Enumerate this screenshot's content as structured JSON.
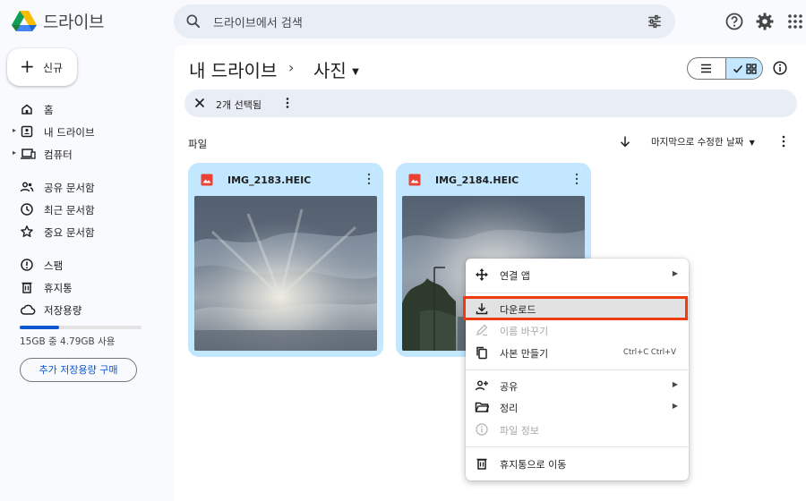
{
  "header": {
    "brand": "드라이브",
    "search_placeholder": "드라이브에서 검색"
  },
  "sidebar": {
    "new_label": "신규",
    "items": [
      {
        "label": "홈",
        "icon": "home-icon"
      },
      {
        "label": "내 드라이브",
        "icon": "my-drive-icon"
      },
      {
        "label": "컴퓨터",
        "icon": "computer-icon"
      },
      {
        "label": "공유 문서함",
        "icon": "shared-icon"
      },
      {
        "label": "최근 문서함",
        "icon": "recent-icon"
      },
      {
        "label": "중요 문서함",
        "icon": "star-icon"
      },
      {
        "label": "스팸",
        "icon": "spam-icon"
      },
      {
        "label": "휴지통",
        "icon": "trash-icon"
      },
      {
        "label": "저장용량",
        "icon": "cloud-icon"
      }
    ],
    "storage_text": "15GB 중 4.79GB 사용",
    "storage_fraction": 0.32,
    "buy_label": "추가 저장용량 구매"
  },
  "breadcrumb": {
    "root": "내 드라이브",
    "separator": "›",
    "current": "사진"
  },
  "selection": {
    "count_label": "2개 선택됨"
  },
  "files": {
    "section_label": "파일",
    "sort_label": "마지막으로 수정한 날짜",
    "items": [
      {
        "name": "IMG_2183.HEIC"
      },
      {
        "name": "IMG_2184.HEIC"
      }
    ]
  },
  "context_menu": {
    "open_with": "연결 앱",
    "download": "다운로드",
    "rename": "이름 바꾸기",
    "copy": "사본 만들기",
    "copy_shortcut": "Ctrl+C Ctrl+V",
    "share": "공유",
    "organize": "정리",
    "file_info": "파일 정보",
    "move_to_trash": "휴지통으로 이동"
  },
  "colors": {
    "accent": "#0b57d0",
    "selected_card": "#c2e7ff",
    "highlight_box": "#ef3b0e"
  }
}
